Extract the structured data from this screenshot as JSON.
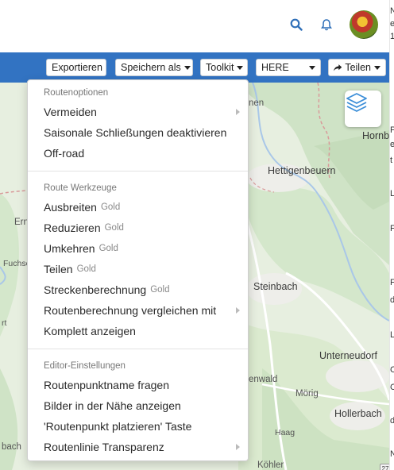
{
  "header": {
    "search_icon": "search-icon",
    "bell_icon": "bell-icon"
  },
  "toolbar": {
    "export_label": "Exportieren",
    "save_as_label": "Speichern als",
    "toolkit_label": "Toolkit",
    "map_provider_value": "HERE",
    "share_label": "Teilen",
    "share_icon": "share-icon",
    "accent_color": "#3273c2"
  },
  "map": {
    "labels": [
      "Ern",
      "Fuchse",
      "rt",
      "nen",
      "Hornb",
      "Hettigenbeuern",
      "Steinbach",
      "Unterneudorf",
      "enwald",
      "Mörig",
      "Hollerbach",
      "Haag",
      "Köhler",
      "bach",
      "27"
    ],
    "layers_icon": "layers-icon",
    "colors": {
      "land": "#e7efe0",
      "forest": "#cfe3c6",
      "urban": "#f1f1ef",
      "water": "#a9c7e8",
      "border": "#d99a9a"
    }
  },
  "menu": {
    "sections": [
      {
        "header": "Routenoptionen",
        "items": [
          {
            "label": "Vermeiden",
            "gold": "",
            "submenu": true
          },
          {
            "label": "Saisonale Schließungen deaktivieren",
            "gold": "",
            "submenu": false
          },
          {
            "label": "Off-road",
            "gold": "",
            "submenu": false
          }
        ]
      },
      {
        "header": "Route Werkzeuge",
        "items": [
          {
            "label": "Ausbreiten",
            "gold": "Gold",
            "submenu": false
          },
          {
            "label": "Reduzieren",
            "gold": "Gold",
            "submenu": false
          },
          {
            "label": "Umkehren",
            "gold": "Gold",
            "submenu": false
          },
          {
            "label": "Teilen",
            "gold": "Gold",
            "submenu": false
          },
          {
            "label": "Streckenberechnung",
            "gold": "Gold",
            "submenu": false
          },
          {
            "label": "Routenberechnung vergleichen mit",
            "gold": "",
            "submenu": true
          },
          {
            "label": "Komplett anzeigen",
            "gold": "",
            "submenu": false
          }
        ]
      },
      {
        "header": "Editor-Einstellungen",
        "items": [
          {
            "label": "Routenpunktname fragen",
            "gold": "",
            "submenu": false
          },
          {
            "label": "Bilder in der Nähe anzeigen",
            "gold": "",
            "submenu": false
          },
          {
            "label": "'Routenpunkt platzieren' Taste",
            "gold": "",
            "submenu": false
          },
          {
            "label": "Routenlinie Transparenz",
            "gold": "",
            "submenu": true
          }
        ]
      }
    ]
  },
  "right_edge": {
    "chars": [
      "N",
      "e",
      "1",
      "P",
      "e",
      "t",
      "L",
      "F",
      "F",
      "d",
      "L",
      "C",
      "C",
      "d",
      "N"
    ]
  }
}
